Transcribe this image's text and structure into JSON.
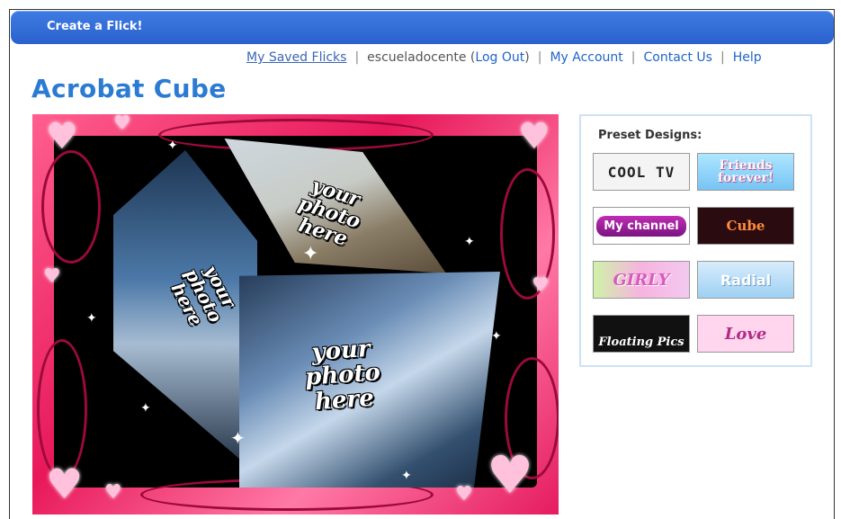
{
  "topbar": {
    "title": "Create a Flick!"
  },
  "nav": {
    "saved": "My Saved Flicks",
    "user": "escueladocente",
    "logout": "Log Out",
    "account": "My Account",
    "contact": "Contact Us",
    "help": "Help"
  },
  "page": {
    "title": "Acrobat Cube"
  },
  "stage": {
    "photo_text_top": "your photo here",
    "photo_text_left": "your photo here",
    "photo_text_front": "your photo here"
  },
  "presets": {
    "title": "Preset Designs:",
    "items": [
      {
        "label": "COOL TV"
      },
      {
        "label": "Friends forever!"
      },
      {
        "label": "My channel"
      },
      {
        "label": "Cube"
      },
      {
        "label": "GIRLY"
      },
      {
        "label": "Radial"
      },
      {
        "label": "Floating Pics"
      },
      {
        "label": "Love"
      }
    ]
  },
  "colors": {
    "topbar": "#2f6ad6",
    "title": "#2b7bd3",
    "link": "#1f64c8"
  }
}
